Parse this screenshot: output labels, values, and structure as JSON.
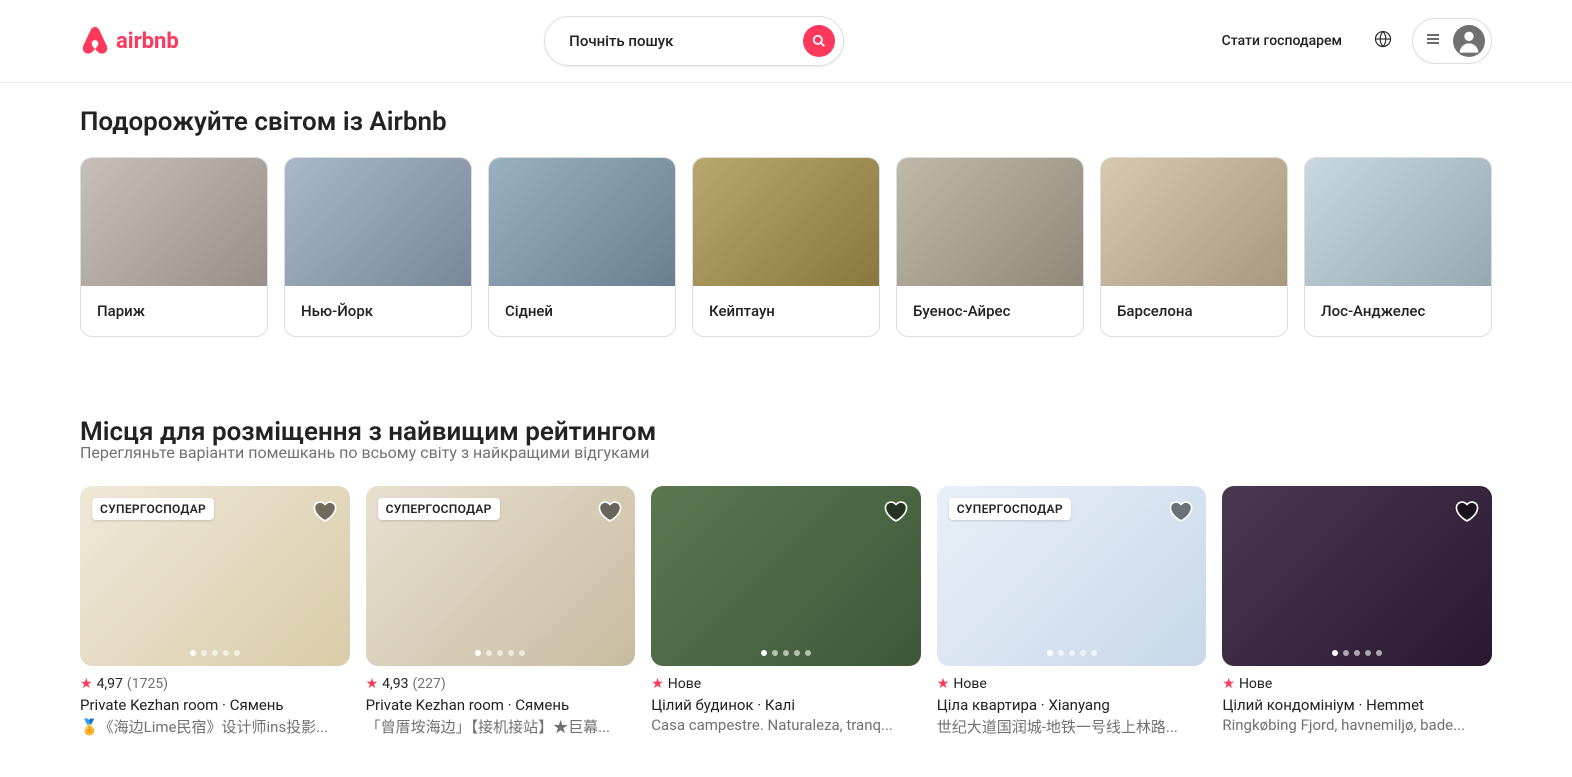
{
  "header": {
    "logo_text": "airbnb",
    "search_placeholder": "Почніть пошук",
    "host_link": "Стати господарем"
  },
  "sections": {
    "destinations_title": "Подорожуйте світом із Airbnb",
    "listings_title": "Місця для розміщення з найвищим рейтингом",
    "listings_subtitle": "Перегляньте варіанти помешкань по всьому світу з найкращими відгуками"
  },
  "destinations": [
    {
      "name": "Париж"
    },
    {
      "name": "Нью-Йорк"
    },
    {
      "name": "Сідней"
    },
    {
      "name": "Кейптаун"
    },
    {
      "name": "Буенос-Айрес"
    },
    {
      "name": "Барселона"
    },
    {
      "name": "Лос-Анджелес"
    }
  ],
  "badge_superhost": "СУПЕРГОСПОДАР",
  "new_label": "Нове",
  "listings": [
    {
      "has_badge": true,
      "rating": "4,97",
      "count": "(1725)",
      "is_new": false,
      "type": "Private Kezhan room · Сямень",
      "name": "🏅《海边Lime民宿》设计师ins投影..."
    },
    {
      "has_badge": true,
      "rating": "4,93",
      "count": "(227)",
      "is_new": false,
      "type": "Private Kezhan room · Сямень",
      "name": "「曾厝垵海边」【接机接站】★巨幕..."
    },
    {
      "has_badge": false,
      "is_new": true,
      "type": "Цілий будинок · Калі",
      "name": "Casa campestre. Naturaleza, tranq..."
    },
    {
      "has_badge": true,
      "is_new": true,
      "type": "Ціла квартира · Xianyang",
      "name": "世纪大道国润城-地铁一号线上林路..."
    },
    {
      "has_badge": false,
      "is_new": true,
      "type": "Цілий кондомініум · Hemmet",
      "name": "Ringkøbing Fjord, havnemiljø, bade..."
    }
  ]
}
